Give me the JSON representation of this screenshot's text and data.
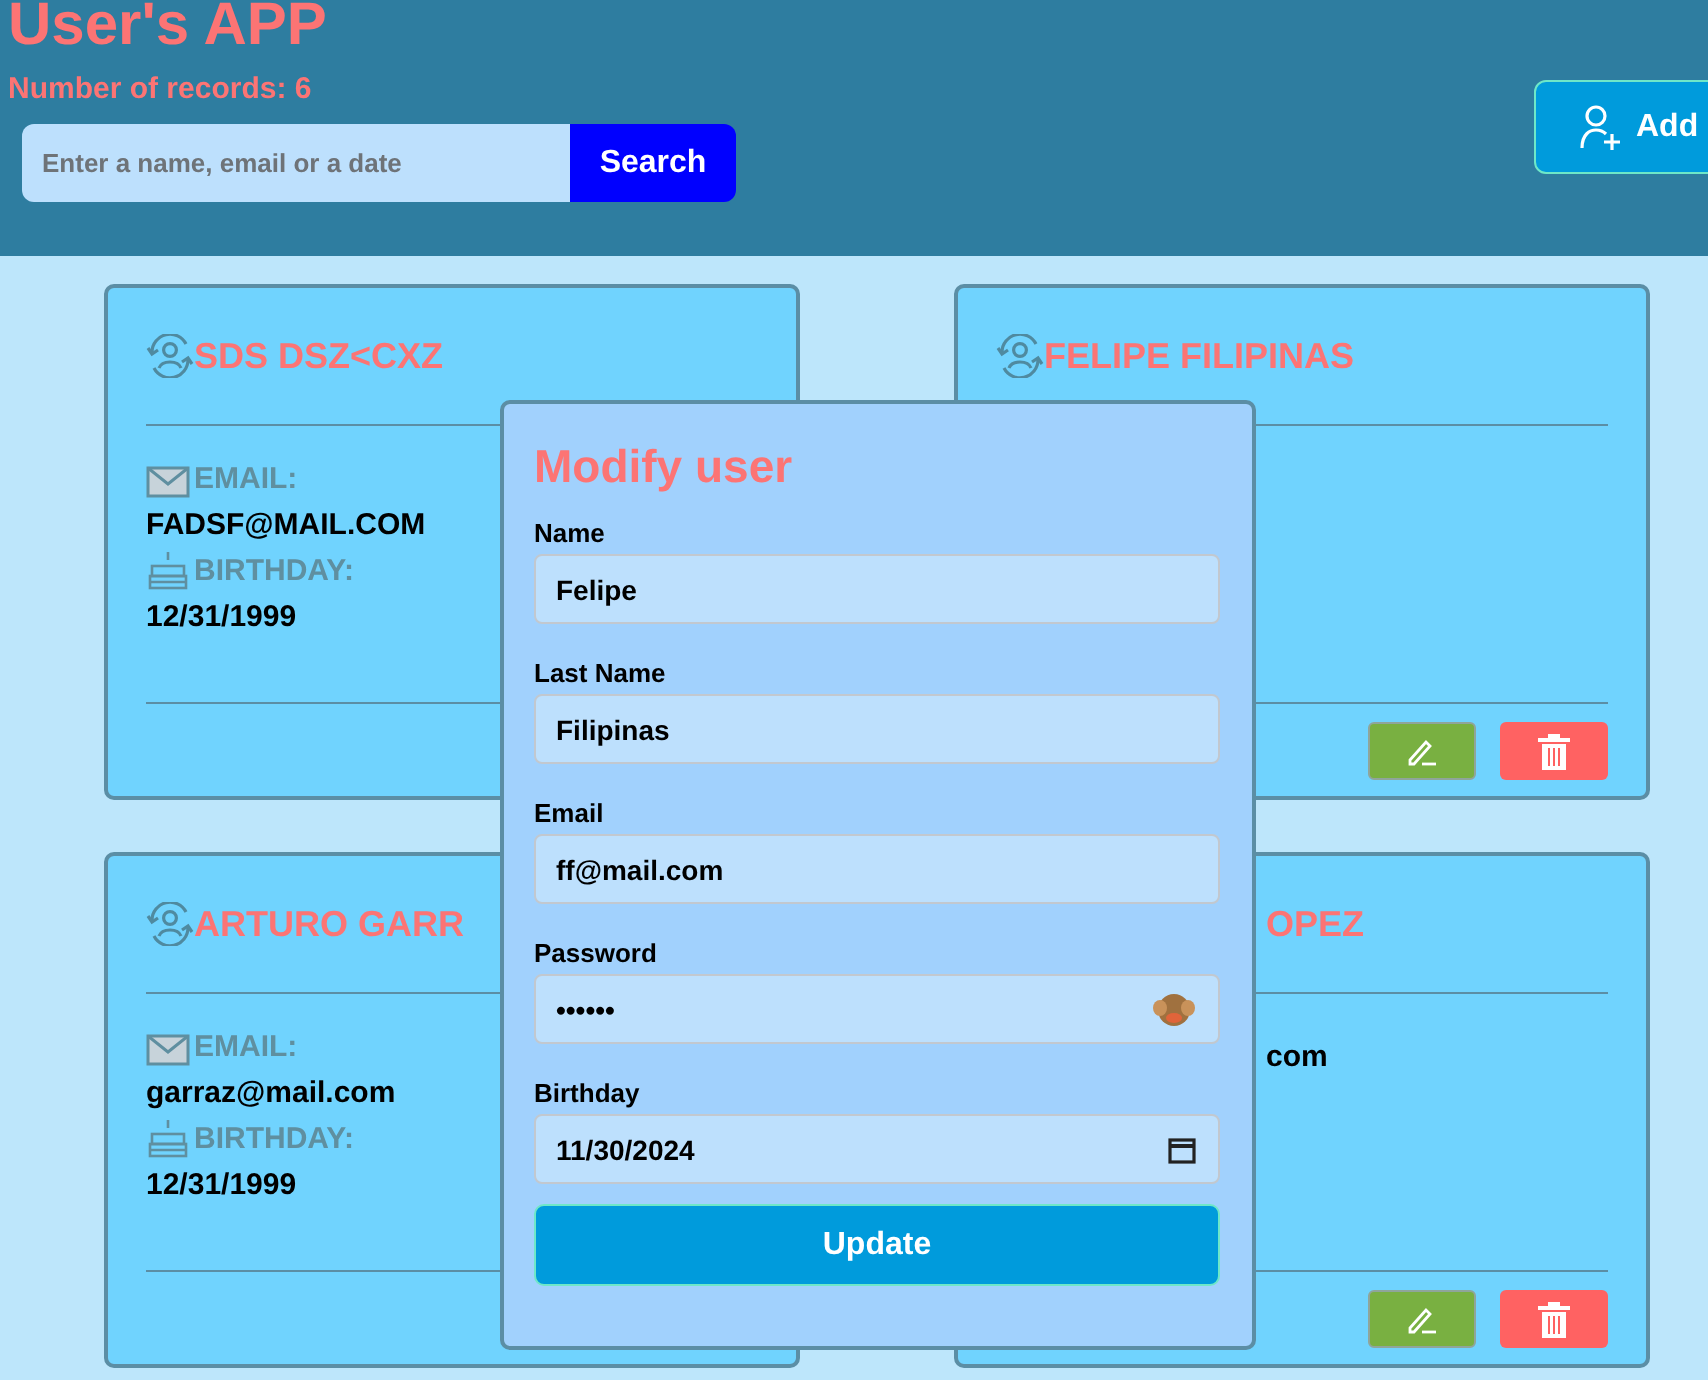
{
  "header": {
    "title": "User's APP",
    "record_count": "Number of records: 6",
    "search": {
      "placeholder": "Enter a name, email or a date",
      "button": "Search"
    },
    "add_button": "Add"
  },
  "cards": [
    {
      "name": "SDS DSZ<CXZ",
      "partial": false,
      "email_label": "EMAIL:",
      "email": "FADSF@MAIL.COM",
      "birthday_label": "BIRTHDAY:",
      "birthday": "12/31/1999"
    },
    {
      "name": "FELIPE FILIPINAS",
      "partial": false,
      "show_actions": true
    },
    {
      "name": "ARTURO GARR",
      "partial": false,
      "email_label": "EMAIL:",
      "email": "garraz@mail.com",
      "birthday_label": "BIRTHDAY:",
      "birthday": "12/31/1999"
    },
    {
      "name": "OPEZ",
      "partial": true,
      "email": "com",
      "show_actions": true
    }
  ],
  "modal": {
    "title": "Modify user",
    "fields": [
      {
        "label": "Name",
        "value": "Felipe",
        "kind": "text"
      },
      {
        "label": "Last Name",
        "value": "Filipinas",
        "kind": "text"
      },
      {
        "label": "Email",
        "value": "ff@mail.com",
        "kind": "text"
      },
      {
        "label": "Password",
        "value": "••••••",
        "kind": "password"
      },
      {
        "label": "Birthday",
        "value": "11/30/2024",
        "kind": "date"
      }
    ],
    "button": "Update"
  }
}
